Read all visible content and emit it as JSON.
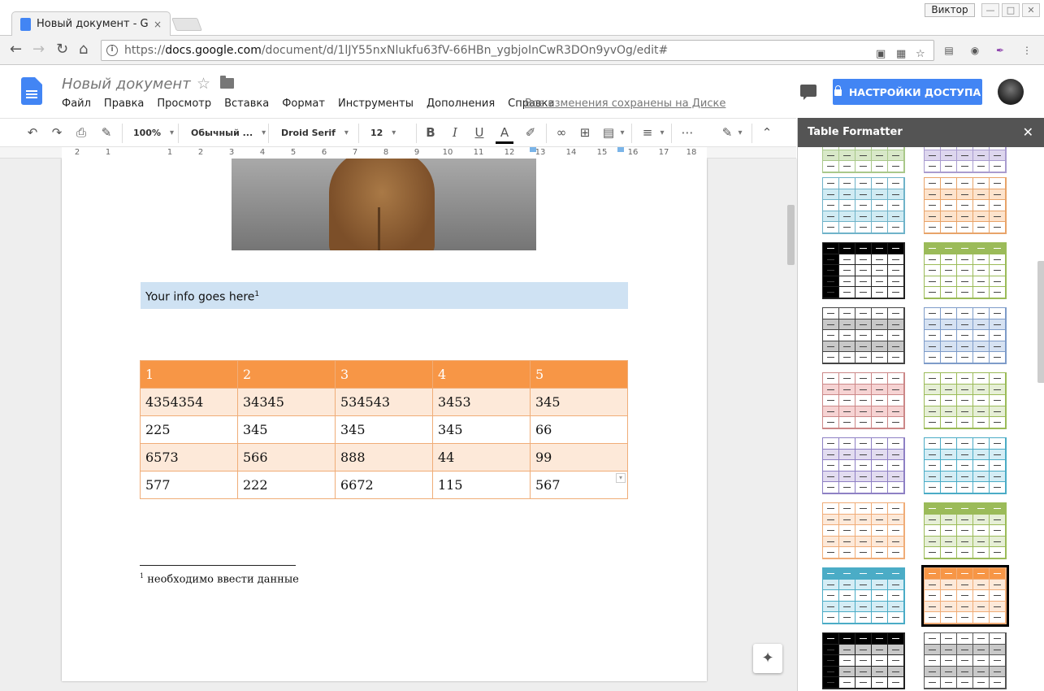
{
  "browser": {
    "tab_title": "Новый документ - G",
    "tab_close": "×",
    "user": "Виктор",
    "window_buttons": [
      "—",
      "□",
      "✕"
    ],
    "url_scheme": "https://",
    "url_host": "docs.google.com",
    "url_path": "/document/d/1lJY55nxNlukfu63fV-66HBn_ygbjoInCwR3DOn9yvOg/edit#"
  },
  "docs": {
    "title": "Новый документ",
    "menu": [
      "Файл",
      "Правка",
      "Просмотр",
      "Вставка",
      "Формат",
      "Инструменты",
      "Дополнения",
      "Справка"
    ],
    "saved_status": "Все изменения сохранены на Диске",
    "share_label": "НАСТРОЙКИ ДОСТУПА"
  },
  "toolbar": {
    "zoom": "100%",
    "style": "Обычный ...",
    "font": "Droid Serif",
    "size": "12"
  },
  "ruler": {
    "labels": [
      "2",
      "1",
      "1",
      "2",
      "3",
      "4",
      "5",
      "6",
      "7",
      "8",
      "9",
      "10",
      "11",
      "12",
      "13",
      "14",
      "15",
      "16",
      "17",
      "18"
    ]
  },
  "document": {
    "info_text": "Your info goes here",
    "info_sup": "1",
    "table": [
      [
        "1",
        "2",
        "3",
        "4",
        "5"
      ],
      [
        "4354354",
        "34345",
        "534543",
        "3453",
        "345"
      ],
      [
        "225",
        "345",
        "345",
        "345",
        "66"
      ],
      [
        "6573",
        "566",
        "888",
        "44",
        "99"
      ],
      [
        "577",
        "222",
        "6672",
        "115",
        "567"
      ]
    ],
    "footnote_num": "1",
    "footnote_text": "необходимо ввести данные"
  },
  "sidebar": {
    "title": "Table Formatter",
    "close": "✕",
    "selected_index": 15,
    "styles": [
      {
        "header": "#ffffff",
        "band": "#d8e8c8",
        "alt": "#ffffff",
        "border": "#a9c88a",
        "dark": false
      },
      {
        "header": "#ffffff",
        "band": "#ddd6ee",
        "alt": "#ffffff",
        "border": "#a99ccf",
        "dark": false
      },
      {
        "header": "#ffffff",
        "band": "#d0ebf3",
        "alt": "#ffffff",
        "border": "#6fb3c9",
        "dark": false
      },
      {
        "header": "#ffffff",
        "band": "#fde3cc",
        "alt": "#ffffff",
        "border": "#e8a46a",
        "dark": false
      },
      {
        "header": "#000000",
        "band": "#ffffff",
        "alt": "#ffffff",
        "border": "#222222",
        "dark": true
      },
      {
        "header": "#9bbb59",
        "band": "#ffffff",
        "alt": "#ffffff",
        "border": "#9bbb59",
        "dark": false
      },
      {
        "header": "#ffffff",
        "band": "#c8c8c8",
        "alt": "#ffffff",
        "border": "#444444",
        "dark": false
      },
      {
        "header": "#ffffff",
        "band": "#d6e2f2",
        "alt": "#ffffff",
        "border": "#7e9cc9",
        "dark": false
      },
      {
        "header": "#ffffff",
        "band": "#f6d3d3",
        "alt": "#ffffff",
        "border": "#cc8888",
        "dark": false
      },
      {
        "header": "#ffffff",
        "band": "#e6efd6",
        "alt": "#ffffff",
        "border": "#9bbb59",
        "dark": false
      },
      {
        "header": "#ffffff",
        "band": "#e2dcf0",
        "alt": "#ffffff",
        "border": "#8e80c4",
        "dark": false
      },
      {
        "header": "#ffffff",
        "band": "#d4edf5",
        "alt": "#ffffff",
        "border": "#4bacc6",
        "dark": false
      },
      {
        "header": "#ffffff",
        "band": "#fde9d9",
        "alt": "#ffffff",
        "border": "#f0ad78",
        "dark": false
      },
      {
        "header": "#9bbb59",
        "band": "#e6efd6",
        "alt": "#ffffff",
        "border": "#9bbb59",
        "dark": false
      },
      {
        "header": "#4bacc6",
        "band": "#d4edf5",
        "alt": "#ffffff",
        "border": "#4bacc6",
        "dark": false
      },
      {
        "header": "#f79646",
        "band": "#fde9d9",
        "alt": "#ffffff",
        "border": "#f0ad78",
        "dark": false
      },
      {
        "header": "#000000",
        "band": "#c8c8c8",
        "alt": "#ffffff",
        "border": "#222222",
        "dark": true
      },
      {
        "header": "#ffffff",
        "band": "#c8c8c8",
        "alt": "#ffffff",
        "border": "#555555",
        "dark": false
      }
    ]
  }
}
